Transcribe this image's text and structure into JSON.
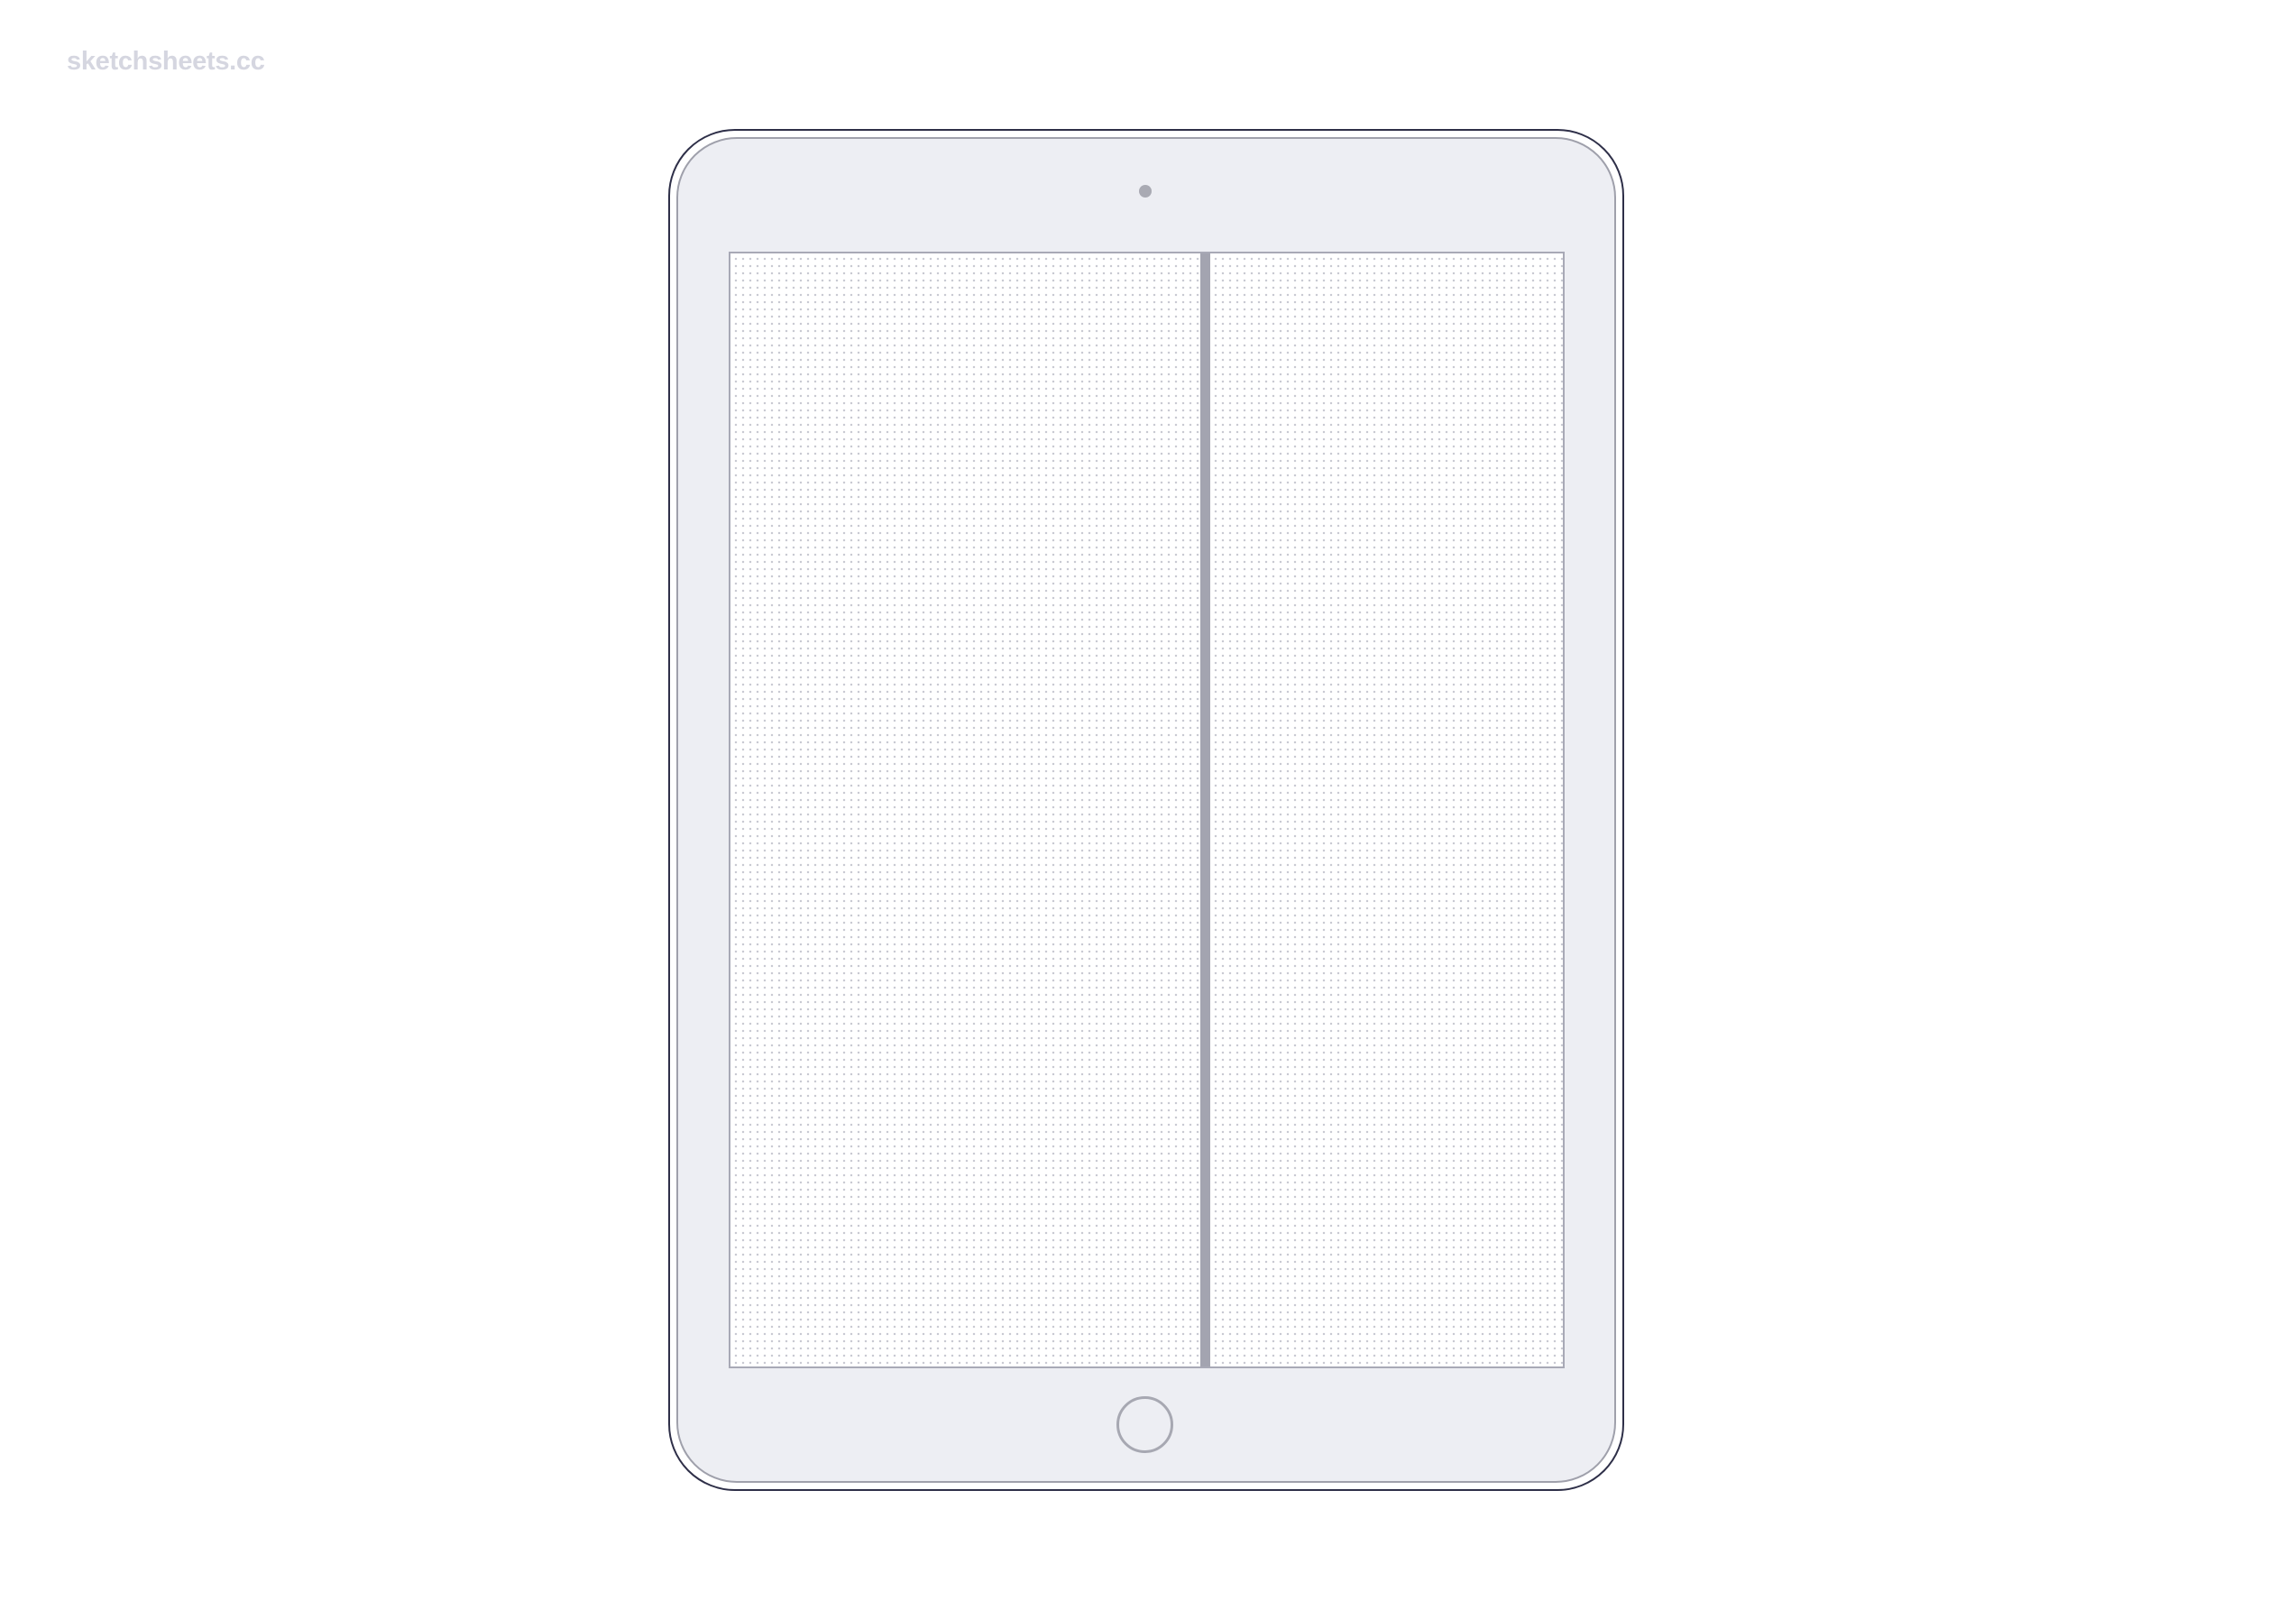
{
  "watermark": {
    "text": "sketchsheets.cc",
    "color": "#d5d6e0"
  },
  "device": {
    "type": "tablet",
    "orientation": "portrait",
    "frame_color": "#2e2f48",
    "bezel_color": "#edeef3",
    "icons": {
      "camera": "camera-dot-icon",
      "home_button": "home-button-circle"
    }
  },
  "screen": {
    "layout": "split-view",
    "pane_count": 2,
    "pattern": "dot-grid",
    "divider_color": "#a3a4b0"
  }
}
